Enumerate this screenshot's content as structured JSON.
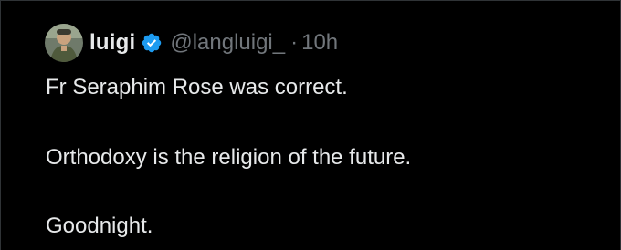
{
  "tweet": {
    "author": {
      "display_name": "luigi",
      "handle": "@langluigi_",
      "verified": true,
      "avatar_icon": "avatar-image"
    },
    "separator": "·",
    "time": "10h",
    "text_lines": [
      "Fr Seraphim Rose was correct.",
      "Orthodoxy is the religion of the future.",
      "Goodnight."
    ]
  },
  "colors": {
    "background": "#000000",
    "primary_text": "#e7e9ea",
    "secondary_text": "#71767b",
    "verified_badge": "#1d9bf0",
    "border": "#2f3336"
  }
}
